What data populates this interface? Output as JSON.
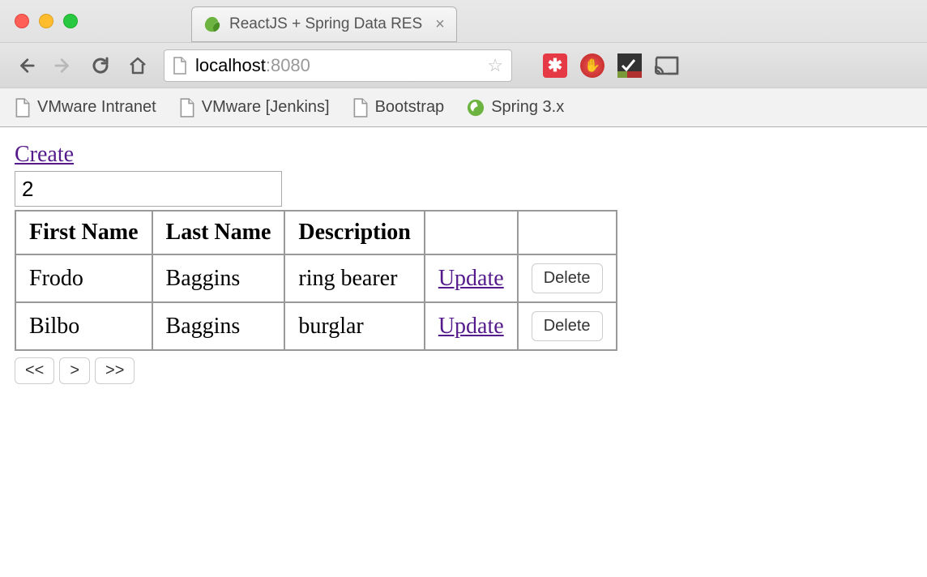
{
  "browser": {
    "tab_title": "ReactJS + Spring Data RES",
    "url_host": "localhost",
    "url_port": ":8080",
    "bookmarks": [
      {
        "label": "VMware Intranet",
        "icon": "file"
      },
      {
        "label": "VMware [Jenkins]",
        "icon": "file"
      },
      {
        "label": "Bootstrap",
        "icon": "file"
      },
      {
        "label": "Spring 3.x",
        "icon": "spring"
      }
    ]
  },
  "app": {
    "create_label": "Create",
    "page_size_value": "2",
    "table": {
      "headers": [
        "First Name",
        "Last Name",
        "Description",
        "",
        ""
      ],
      "rows": [
        {
          "first_name": "Frodo",
          "last_name": "Baggins",
          "description": "ring bearer"
        },
        {
          "first_name": "Bilbo",
          "last_name": "Baggins",
          "description": "burglar"
        }
      ],
      "update_label": "Update",
      "delete_label": "Delete"
    },
    "pagination": {
      "first": "<<",
      "next": ">",
      "last": ">>"
    }
  }
}
